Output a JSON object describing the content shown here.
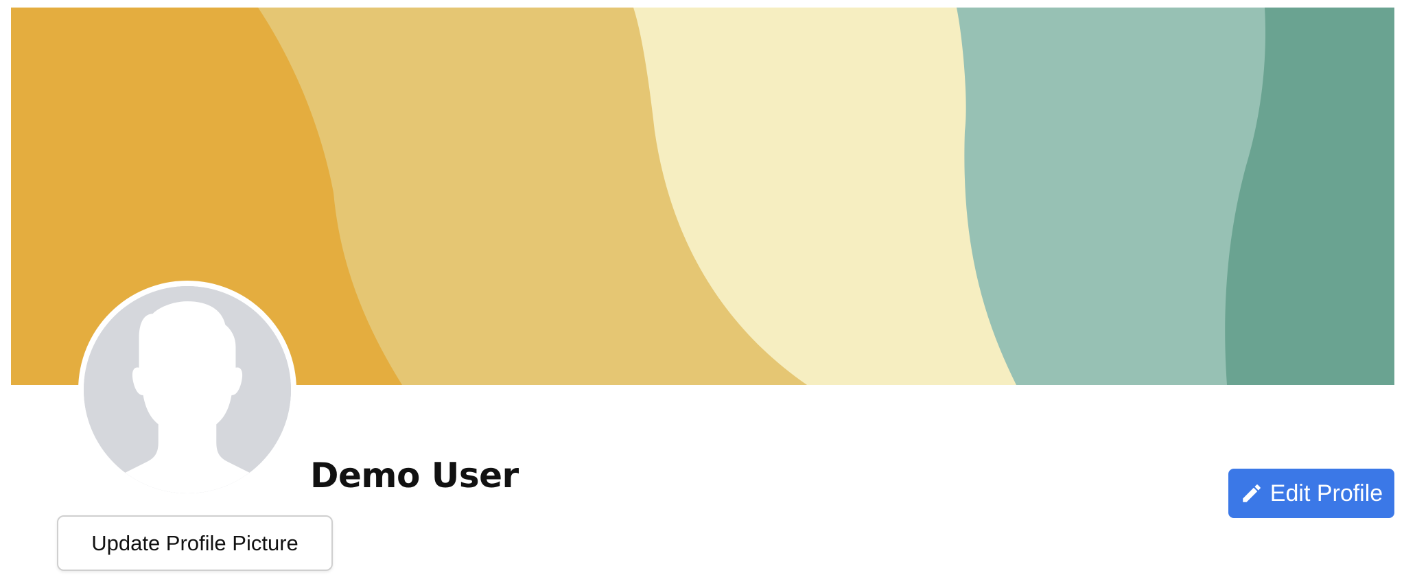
{
  "profile": {
    "name": "Demo User"
  },
  "buttons": {
    "edit_profile": "Edit Profile",
    "update_picture": "Update Profile Picture"
  },
  "icons": {
    "edit": "pencil-icon",
    "avatar": "person-silhouette-icon"
  },
  "colors": {
    "cover_bands": [
      "#e4ad3f",
      "#e5c673",
      "#f6eec1",
      "#97c1b4",
      "#6aa391"
    ],
    "accent": "#3b78e7",
    "avatar_bg": "#d5d7dc"
  }
}
